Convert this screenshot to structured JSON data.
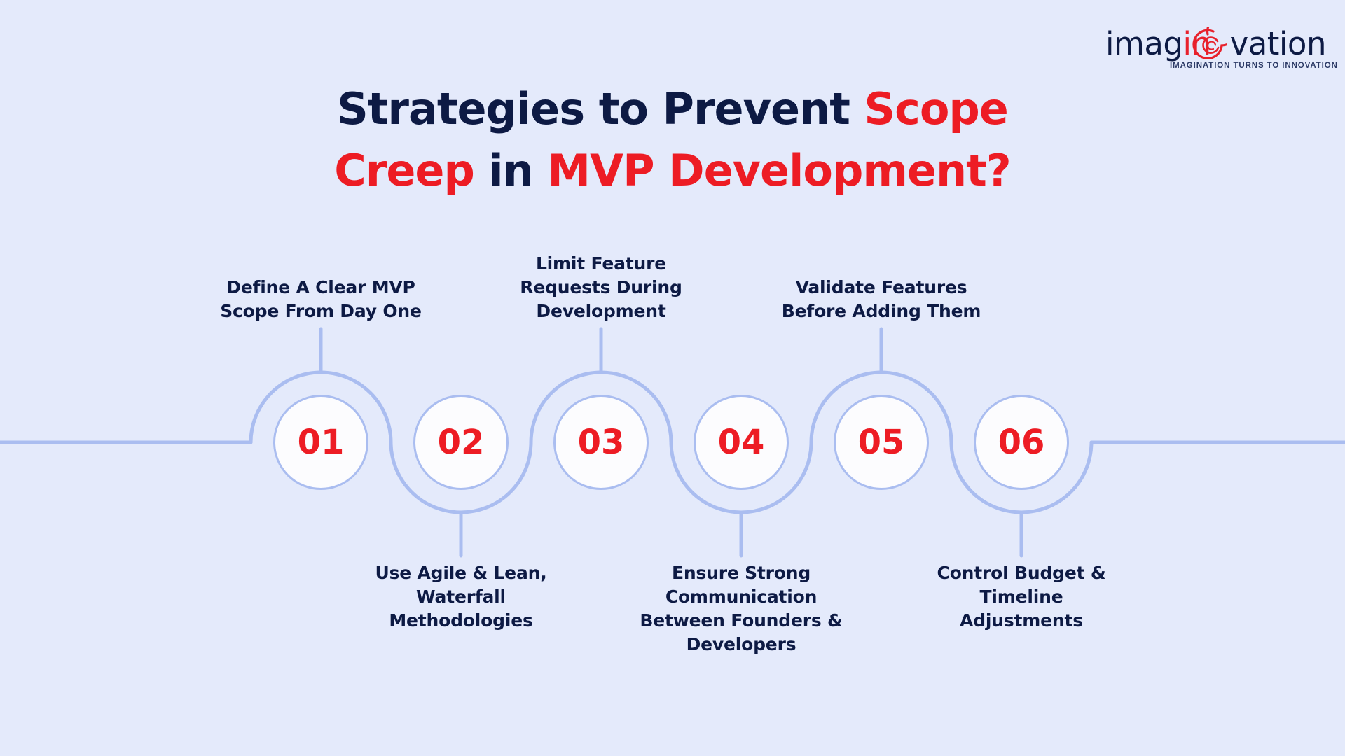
{
  "background_color": "#e4eafb",
  "accent_color": "#ed1c24",
  "navy_color": "#0d1a44",
  "line_color": "#aabdf0",
  "logo": {
    "word_part1": "imag",
    "word_part2": "in",
    "word_part3": "vation",
    "tagline": "IMAGINATION TURNS TO INNOVATION"
  },
  "title": {
    "line1_a": "Strategies to Prevent ",
    "line1_b": "Scope",
    "line2_a": "Creep",
    "line2_b": " in ",
    "line2_c": "MVP Development?"
  },
  "steps": [
    {
      "number": "01",
      "label": "Define A Clear MVP Scope From Day One",
      "position": "above"
    },
    {
      "number": "02",
      "label": "Use Agile & Lean, Waterfall Methodologies",
      "position": "below"
    },
    {
      "number": "03",
      "label": "Limit Feature Requests During Development",
      "position": "above"
    },
    {
      "number": "04",
      "label": "Ensure Strong Communication Between Founders & Developers",
      "position": "below"
    },
    {
      "number": "05",
      "label": "Validate Features Before Adding Them",
      "position": "above"
    },
    {
      "number": "06",
      "label": "Control Budget & Timeline Adjustments",
      "position": "below"
    }
  ]
}
